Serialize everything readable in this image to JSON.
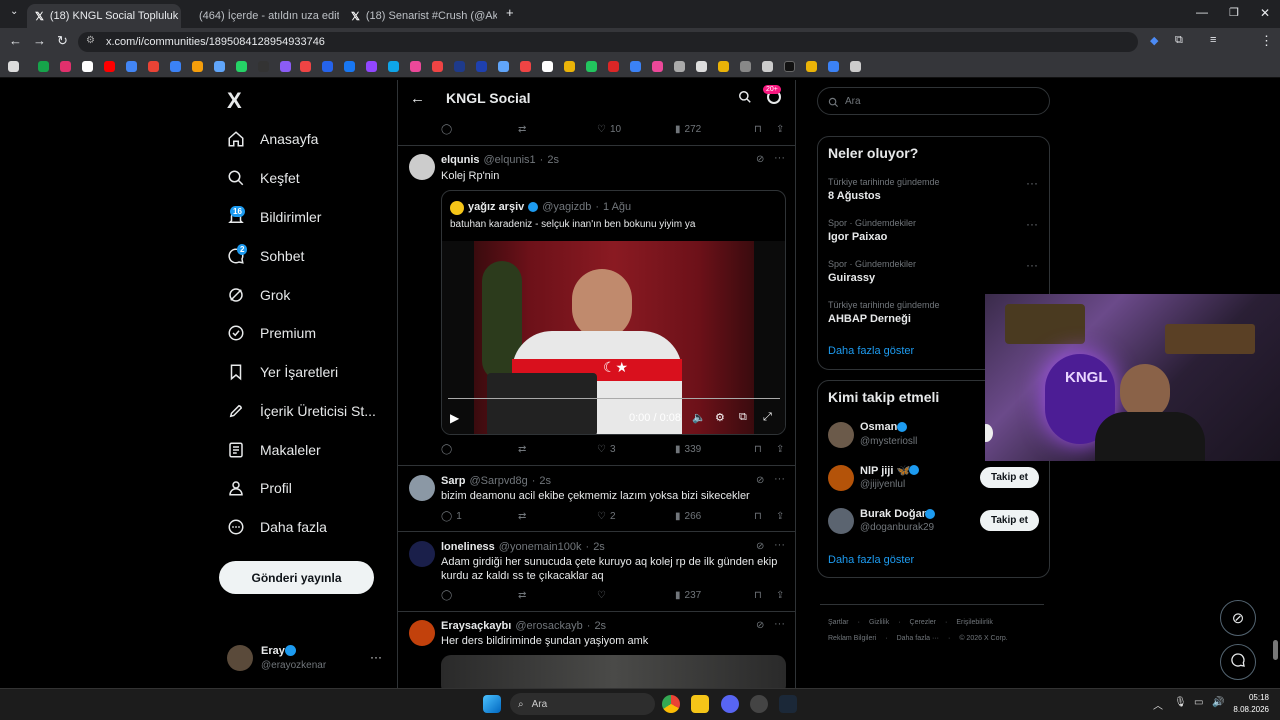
{
  "browser": {
    "tabs": [
      {
        "title": "(18) KNGL Social Topluluk / X",
        "active": true,
        "icon": "x-icon"
      },
      {
        "title": "(464) İçerde - atıldın uza edit - ",
        "active": false,
        "icon": "youtube-icon"
      },
      {
        "title": "(18) Senarist #Crush (@Akali34",
        "active": false,
        "icon": "x-icon"
      }
    ],
    "url": "x.com/i/communities/1895084128954933746"
  },
  "nav": {
    "logo": "X",
    "items": [
      {
        "label": "Anasayfa",
        "icon": "home-icon"
      },
      {
        "label": "Keşfet",
        "icon": "search-icon"
      },
      {
        "label": "Bildirimler",
        "icon": "bell-icon",
        "badge": "16"
      },
      {
        "label": "Sohbet",
        "icon": "chat-icon",
        "badge": "2"
      },
      {
        "label": "Grok",
        "icon": "grok-icon"
      },
      {
        "label": "Premium",
        "icon": "premium-icon"
      },
      {
        "label": "Yer İşaretleri",
        "icon": "bookmark-icon"
      },
      {
        "label": "İçerik Üreticisi St...",
        "icon": "rocket-icon"
      },
      {
        "label": "Makaleler",
        "icon": "article-icon"
      },
      {
        "label": "Profil",
        "icon": "person-icon"
      },
      {
        "label": "Daha fazla",
        "icon": "more-icon"
      }
    ],
    "post_button": "Gönderi yayınla",
    "account": {
      "name": "Eray",
      "handle": "@erayozkenar"
    }
  },
  "header": {
    "title": "KNGL Social",
    "badge": "20+"
  },
  "top_actions": {
    "likes": "10",
    "views": "272"
  },
  "tweets": [
    {
      "name": "elqunis",
      "handle": "@elqunis1",
      "time": "2s",
      "text": "Kolej Rp'nin",
      "quote": {
        "name": "yağız arşiv",
        "handle": "@yagizdb",
        "time": "1 Ağu",
        "text": "batuhan karadeniz - selçuk inan'ın ben bokunu yiyim ya"
      },
      "video_time": "0:00 / 0:08",
      "likes": "3",
      "views": "339",
      "replies": ""
    },
    {
      "name": "Sarp",
      "handle": "@Sarpvd8g",
      "time": "2s",
      "text": "bizim deamonu acil ekibe çekmemiz lazım yoksa bizi sikecekler",
      "replies": "1",
      "likes": "2",
      "views": "266"
    },
    {
      "name": "loneliness",
      "handle": "@yonemain100k",
      "time": "2s",
      "text": "Adam girdiği her sunucuda çete kuruyo aq kolej rp de ilk günden ekip kurdu az kaldı ss te çıkacaklar aq",
      "replies": "",
      "likes": "",
      "views": "237"
    },
    {
      "name": "Eraysaçkaybı",
      "handle": "@erosackayb",
      "time": "2s",
      "text": "Her ders bildiriminde şundan yaşiyom amk"
    }
  ],
  "search": {
    "placeholder": "Ara"
  },
  "trends": {
    "title": "Neler oluyor?",
    "items": [
      {
        "category": "Türkiye tarihinde gündemde",
        "name": "8 Ağustos"
      },
      {
        "category": "Spor · Gündemdekiler",
        "name": "Igor Paixao"
      },
      {
        "category": "Spor · Gündemdekiler",
        "name": "Guirassy"
      },
      {
        "category": "Türkiye tarihinde gündemde",
        "name": "AHBAP Derneği"
      }
    ],
    "more": "Daha fazla göster"
  },
  "who_to_follow": {
    "title": "Kimi takip etmeli",
    "items": [
      {
        "name": "Osman",
        "handle": "@mysteriosll"
      },
      {
        "name": "NlP jiji 🦋",
        "handle": "@jijiyenlul",
        "button": "Takip et"
      },
      {
        "name": "Burak Doğan",
        "handle": "@doganburak29",
        "button": "Takip et"
      }
    ],
    "more": "Daha fazla göster"
  },
  "footer": {
    "links": [
      "Şartlar",
      "Gizlilik",
      "Çerezler",
      "Erişilebilirlik",
      "Reklam Bilgileri",
      "Daha fazla ···",
      "© 2026 X Corp."
    ]
  },
  "taskbar": {
    "search": "Ara",
    "time": "05:18",
    "date": "8.08.2026"
  },
  "colors": {
    "accent": "#1d9bf0",
    "background": "#000000",
    "border": "#2f3336",
    "muted": "#71767b",
    "badge_pink": "#f91880"
  }
}
